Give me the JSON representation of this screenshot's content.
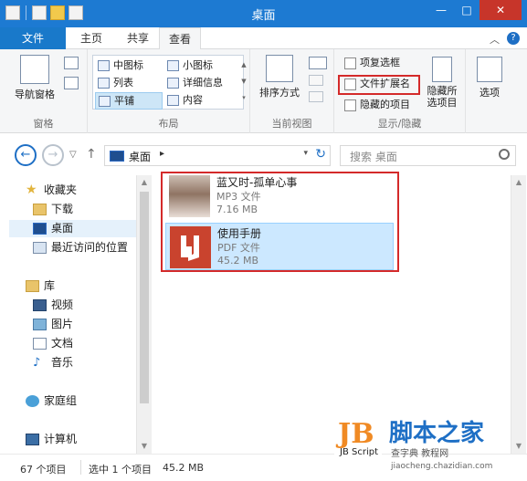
{
  "window": {
    "title": "桌面",
    "controls": {
      "minimize": "—",
      "maximize": "□",
      "close": "✕"
    }
  },
  "ribbon_tabs": [
    {
      "label": "文件"
    },
    {
      "label": "主页"
    },
    {
      "label": "共享"
    },
    {
      "label": "查看"
    }
  ],
  "ribbon": {
    "panes": {
      "nav_pane_label": "导航窗格",
      "group_label": "窗格"
    },
    "layout": {
      "options": [
        "中图标",
        "小图标",
        "列表",
        "详细信息",
        "平铺",
        "内容"
      ],
      "selected": "平铺",
      "group_label": "布局"
    },
    "current_view": {
      "sort_label": "排序方式",
      "group_label": "当前视图"
    },
    "show_hide": {
      "checkboxes": [
        {
          "label": "项复选框",
          "checked": false
        },
        {
          "label": "文件扩展名",
          "checked": false
        },
        {
          "label": "隐藏的项目",
          "checked": false
        }
      ],
      "hide_selected_label": "隐藏所选项目",
      "group_label": "显示/隐藏"
    },
    "options_label": "选项"
  },
  "address": {
    "location": "桌面",
    "search_placeholder": "搜索 桌面"
  },
  "nav_pane": {
    "items": [
      {
        "label": "收藏夹",
        "icon": "star-icon"
      },
      {
        "label": "下载",
        "icon": "download-folder-icon"
      },
      {
        "label": "桌面",
        "icon": "desktop-icon",
        "selected": true
      },
      {
        "label": "最近访问的位置",
        "icon": "recent-places-icon"
      },
      {
        "label": "库",
        "icon": "library-icon"
      },
      {
        "label": "视频",
        "icon": "video-icon"
      },
      {
        "label": "图片",
        "icon": "pictures-icon"
      },
      {
        "label": "文档",
        "icon": "documents-icon"
      },
      {
        "label": "音乐",
        "icon": "music-icon"
      },
      {
        "label": "家庭组",
        "icon": "homegroup-icon"
      },
      {
        "label": "计算机",
        "icon": "computer-icon"
      }
    ]
  },
  "files": [
    {
      "name": "蓝又时-孤单心事",
      "type": "MP3 文件",
      "size": "7.16 MB",
      "selected": false
    },
    {
      "name": "使用手册",
      "type": "PDF 文件",
      "size": "45.2 MB",
      "selected": true
    }
  ],
  "status": {
    "count": "67 个项目",
    "selection": "选中 1 个项目",
    "size": "45.2 MB"
  },
  "watermark": {
    "logo": "JB Script",
    "site": "脚本之家",
    "url": "jiaocheng.chazidian.com",
    "brand": "查字典 教程网"
  },
  "colors": {
    "titlebar": "#1d7ad2",
    "file_tab": "#1979ca",
    "highlight_box": "#d42a2a",
    "selected_item": "#cce8ff"
  }
}
